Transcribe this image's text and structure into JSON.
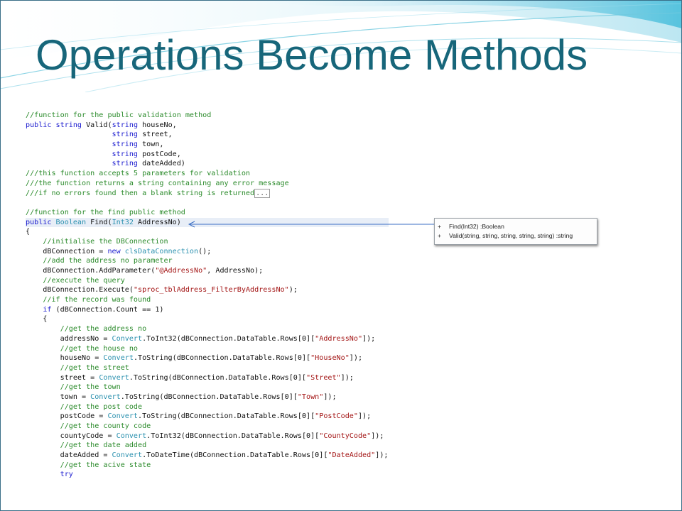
{
  "slide": {
    "title": "Operations Become Methods"
  },
  "code": {
    "lines": [
      "//function for the public validation method",
      "public string Valid(string houseNo,",
      "                    string street,",
      "                    string town,",
      "                    string postCode,",
      "                    string dateAdded)",
      "///this function accepts 5 parameters for validation",
      "///the function returns a string containing any error message",
      "///if no errors found then a blank string is returned...",
      "",
      "//function for the find public method",
      "public Boolean Find(Int32 AddressNo)",
      "{",
      "    //initialise the DBConnection",
      "    dBConnection = new clsDataConnection();",
      "    //add the address no parameter",
      "    dBConnection.AddParameter(\"@AddressNo\", AddressNo);",
      "    //execute the query",
      "    dBConnection.Execute(\"sproc_tblAddress_FilterByAddressNo\");",
      "    //if the record was found",
      "    if (dBConnection.Count == 1)",
      "    {",
      "        //get the address no",
      "        addressNo = Convert.ToInt32(dBConnection.DataTable.Rows[0][\"AddressNo\"]);",
      "        //get the house no",
      "        houseNo = Convert.ToString(dBConnection.DataTable.Rows[0][\"HouseNo\"]);",
      "        //get the street",
      "        street = Convert.ToString(dBConnection.DataTable.Rows[0][\"Street\"]);",
      "        //get the town",
      "        town = Convert.ToString(dBConnection.DataTable.Rows[0][\"Town\"]);",
      "        //get the post code",
      "        postCode = Convert.ToString(dBConnection.DataTable.Rows[0][\"PostCode\"]);",
      "        //get the county code",
      "        countyCode = Convert.ToInt32(dBConnection.DataTable.Rows[0][\"CountyCode\"]);",
      "        //get the date added",
      "        dateAdded = Convert.ToDateTime(dBConnection.DataTable.Rows[0][\"DateAdded\"]);",
      "        //get the acive state",
      "        try"
    ]
  },
  "uml": {
    "rows": [
      {
        "visibility": "+",
        "signature": "Find(Int32)  :Boolean"
      },
      {
        "visibility": "+",
        "signature": "Valid(string, string, string, string, string)  :string"
      }
    ]
  },
  "colors": {
    "title": "#17667a",
    "comment": "#2a8a2a",
    "keyword": "#1a1acf",
    "string": "#a31515",
    "type": "#2b91af"
  }
}
